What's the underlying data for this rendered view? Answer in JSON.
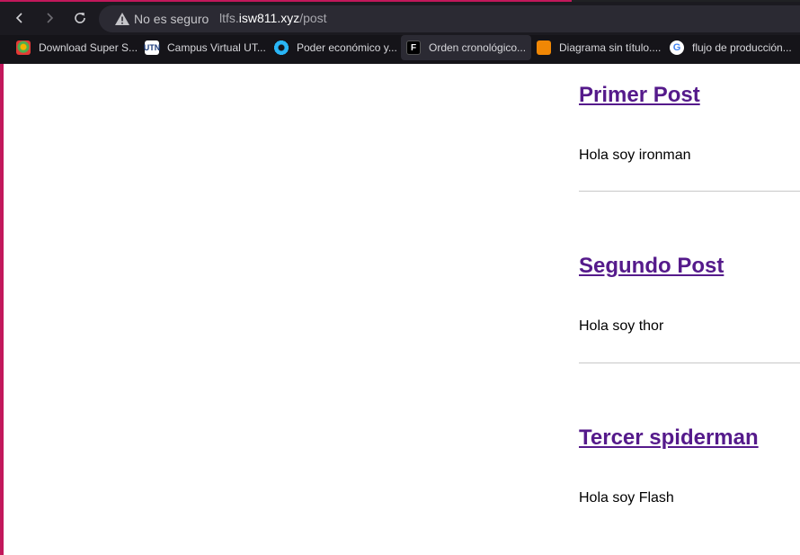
{
  "browser": {
    "security_label": "No es seguro",
    "url": {
      "prefix": "ltfs.",
      "host": "isw811.xyz",
      "path": "/post"
    },
    "accent_color": "#c2185b"
  },
  "bookmarks": [
    {
      "label": "Download Super S...",
      "icon": "superstar-icon"
    },
    {
      "label": "Campus Virtual UT...",
      "icon": "campus-icon"
    },
    {
      "label": "Poder económico y...",
      "icon": "globe-icon"
    },
    {
      "label": "Orden cronológico...",
      "icon": "figma-icon"
    },
    {
      "label": "Diagrama sin título....",
      "icon": "drawio-icon"
    },
    {
      "label": "flujo de producción...",
      "icon": "google-icon"
    }
  ],
  "posts": [
    {
      "title": "Primer Post",
      "body": "Hola soy ironman"
    },
    {
      "title": "Segundo Post",
      "body": "Hola soy thor"
    },
    {
      "title": "Tercer spiderman",
      "body": "Hola soy Flash"
    }
  ],
  "colors": {
    "link": "#551a8b",
    "separator": "#c8c8c8"
  }
}
